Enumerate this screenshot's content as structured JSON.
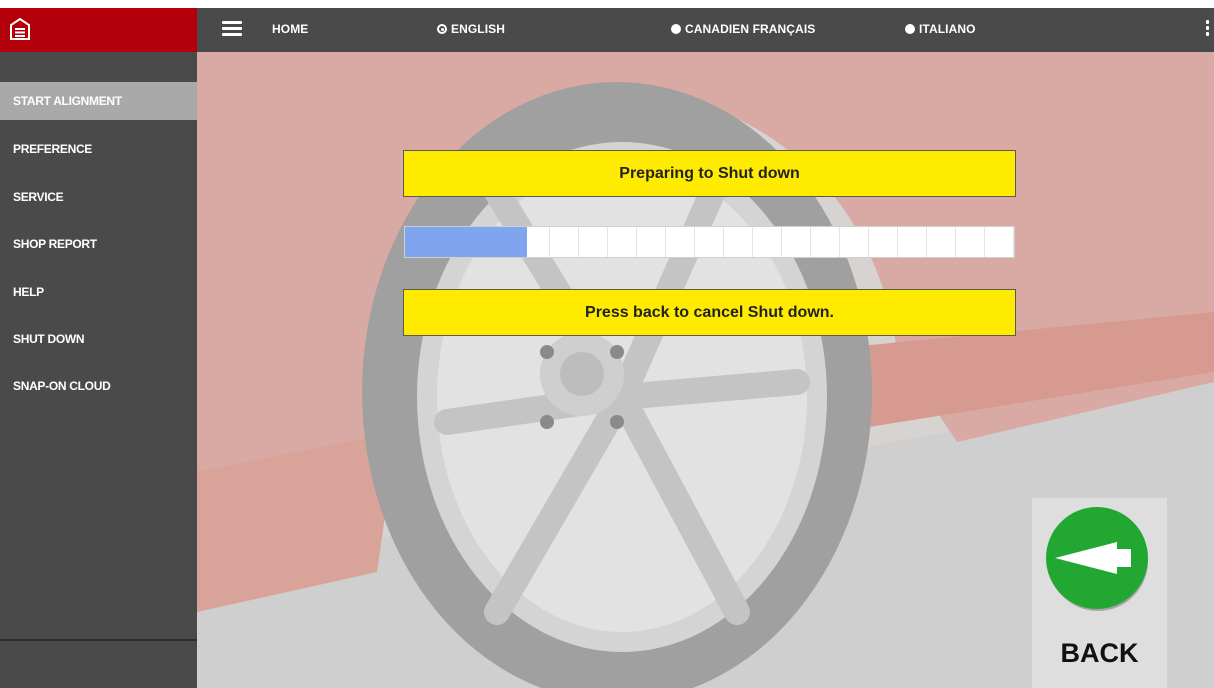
{
  "topbar": {
    "home_label": "HOME",
    "languages": [
      {
        "label": "ENGLISH",
        "selected": true
      },
      {
        "label": "CANADIEN FRANÇAIS",
        "selected": false
      },
      {
        "label": "ITALIANO",
        "selected": false
      }
    ],
    "colors": {
      "logo_bg": "#b3000a",
      "bar_bg": "#4a4a4a"
    }
  },
  "sidebar": {
    "items": [
      {
        "label": "START ALIGNMENT",
        "active": true
      },
      {
        "label": "PREFERENCE",
        "active": false
      },
      {
        "label": "SERVICE",
        "active": false
      },
      {
        "label": "SHOP REPORT",
        "active": false
      },
      {
        "label": "HELP",
        "active": false
      },
      {
        "label": "SHUT DOWN",
        "active": false
      },
      {
        "label": "SNAP-ON CLOUD",
        "active": false
      }
    ]
  },
  "main": {
    "title_message": "Preparing to Shut down",
    "cancel_message": "Press back to cancel Shut down.",
    "progress": {
      "fraction": 0.2,
      "segments": 21
    },
    "back_button": {
      "label": "BACK",
      "color": "#22a832"
    },
    "message_color": "#ffeb00"
  }
}
